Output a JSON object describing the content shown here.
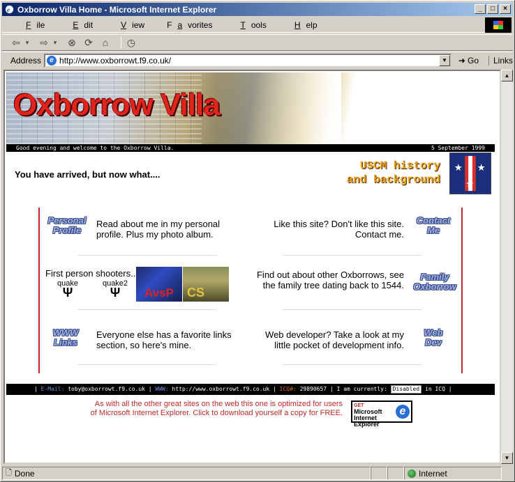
{
  "window": {
    "title": "Oxborrow Villa Home - Microsoft Internet Explorer",
    "controls": {
      "minimize": "_",
      "maximize": "□",
      "close": "×"
    }
  },
  "menu": [
    {
      "pre": "",
      "u": "F",
      "post": "ile"
    },
    {
      "pre": "",
      "u": "E",
      "post": "dit"
    },
    {
      "pre": "",
      "u": "V",
      "post": "iew"
    },
    {
      "pre": "F",
      "u": "a",
      "post": "vorites"
    },
    {
      "pre": "",
      "u": "T",
      "post": "ools"
    },
    {
      "pre": "",
      "u": "H",
      "post": "elp"
    }
  ],
  "toolbar": {
    "back": "⇦",
    "back_dd": "▾",
    "forward": "⇨",
    "forward_dd": "▾",
    "stop": "⊗",
    "refresh": "⟳",
    "home": "⌂",
    "history": "◷"
  },
  "address": {
    "label": "Address",
    "url": "http://www.oxborrowt.f9.co.uk/",
    "go": "Go",
    "links": "Links",
    "dropdown": "▼"
  },
  "page": {
    "banner_title": "Oxborrow Villa",
    "welcome": "Good evening and welcome to the Oxborrow Villa.",
    "date": "5 September 1999",
    "arrived": "You have arrived, but now what....",
    "uscm_line1": "USCM history",
    "uscm_line2": "and background",
    "sections": {
      "personal_icon": [
        "Personal",
        "Profile"
      ],
      "personal_text": "Read about me in my personal profile.  Plus my photo album.",
      "contact_icon": [
        "Contact",
        "Me"
      ],
      "contact_text": "Like this site? Don't like this site. Contact me.",
      "fps_title": "First person shooters...",
      "quake": "quake",
      "quake2": "quake2",
      "avsp": "AvsP",
      "cs": "CS",
      "family_icon": [
        "Family",
        "Oxborrow"
      ],
      "family_text": "Find out about other Oxborrows, see the family tree dating back to 1544.",
      "links_icon": [
        "WWW",
        "Links"
      ],
      "links_text": "Everyone else has a favorite links section, so here's mine.",
      "webdev_icon": [
        "Web",
        "Dev"
      ],
      "webdev_text": "Web developer? Take a look at my little pocket of development info."
    },
    "footer": {
      "email_label": "E-Mail:",
      "email": "toby@oxborrowt.f9.co.uk",
      "www_label": "WWW:",
      "www": "http://www.oxborrowt.f9.co.uk",
      "icq_label": "ICQ#:",
      "icq": "29890657",
      "status_prefix": "I am currently:",
      "status_badge": "Disabled",
      "status_suffix": "in ICQ"
    },
    "optimized": "As with all the other great sites on the web this one is optimized for users of Microsoft Internet Explorer. Click to download yourself a copy for FREE.",
    "get_ie": {
      "get": "GET",
      "line1": "Microsoft",
      "line2": "Internet",
      "line3": "Explorer"
    }
  },
  "status": {
    "left": "Done",
    "zone": "Internet"
  }
}
